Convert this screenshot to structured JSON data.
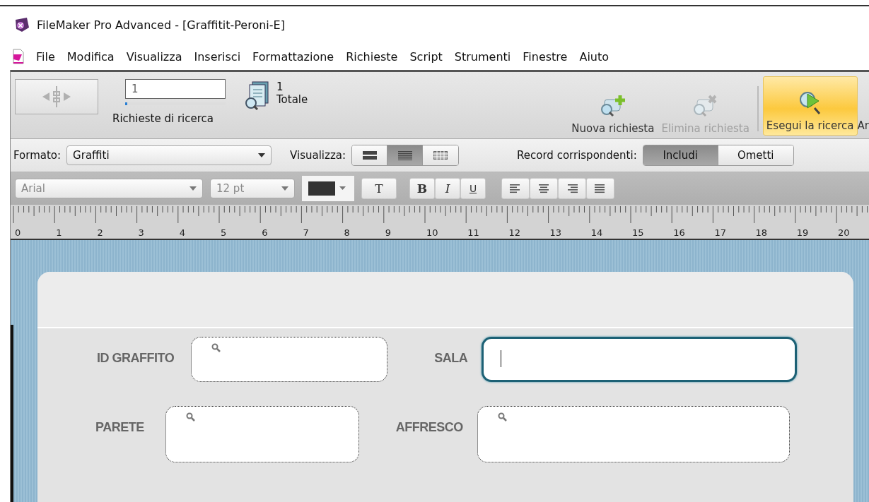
{
  "window": {
    "title": "FileMaker Pro Advanced - [Graffitit-Peroni-E]"
  },
  "menu": [
    "File",
    "Modifica",
    "Visualizza",
    "Inserisci",
    "Formattazione",
    "Richieste",
    "Script",
    "Strumenti",
    "Finestre",
    "Aiuto"
  ],
  "toolbar": {
    "record_field": {
      "value": "1"
    },
    "record_slider": {
      "level": 0.02
    },
    "record_label": "Richieste di ricerca",
    "found_count": "1",
    "found_label": "Totale",
    "buttons": [
      {
        "label": "Nuova richiesta",
        "kind": "new",
        "disabled": false,
        "selected": false
      },
      {
        "label": "Elimina richiesta",
        "kind": "delete",
        "disabled": true,
        "selected": false
      },
      {
        "label": "Esegui la ricerca",
        "kind": "find",
        "disabled": false,
        "selected": true
      }
    ],
    "cut_label": "Ar"
  },
  "layout_bar": {
    "layout_label": "Formato:",
    "layout_value": "Graffiti",
    "view_label": "Visualizza:",
    "views": [
      {
        "kind": "form",
        "selected": false
      },
      {
        "kind": "list",
        "selected": true
      },
      {
        "kind": "table",
        "selected": false
      }
    ],
    "match_label": "Record corrispondenti:",
    "match_options": [
      {
        "label": "Includi",
        "selected": true
      },
      {
        "label": "Ometti",
        "selected": false
      }
    ]
  },
  "format_bar": {
    "disabled": true,
    "font": "Arial",
    "size": "12 pt",
    "text_button": "T",
    "styles": [
      "B",
      "I",
      "U"
    ],
    "aligns": [
      {
        "kind": "left"
      },
      {
        "kind": "center"
      },
      {
        "kind": "right"
      },
      {
        "kind": "justify"
      }
    ]
  },
  "ruler": {
    "labels": [
      "0",
      "1",
      "2",
      "3",
      "4",
      "5",
      "6",
      "7",
      "8",
      "9",
      "10",
      "11",
      "12",
      "13",
      "14",
      "15",
      "16",
      "17",
      "18",
      "19",
      "20"
    ]
  },
  "form": {
    "fields": [
      {
        "label": "ID GRAFFITO",
        "focused": false
      },
      {
        "label": "SALA",
        "focused": true
      },
      {
        "label": "PARETE",
        "focused": false
      },
      {
        "label": "AFFRESCO",
        "focused": false
      }
    ]
  }
}
